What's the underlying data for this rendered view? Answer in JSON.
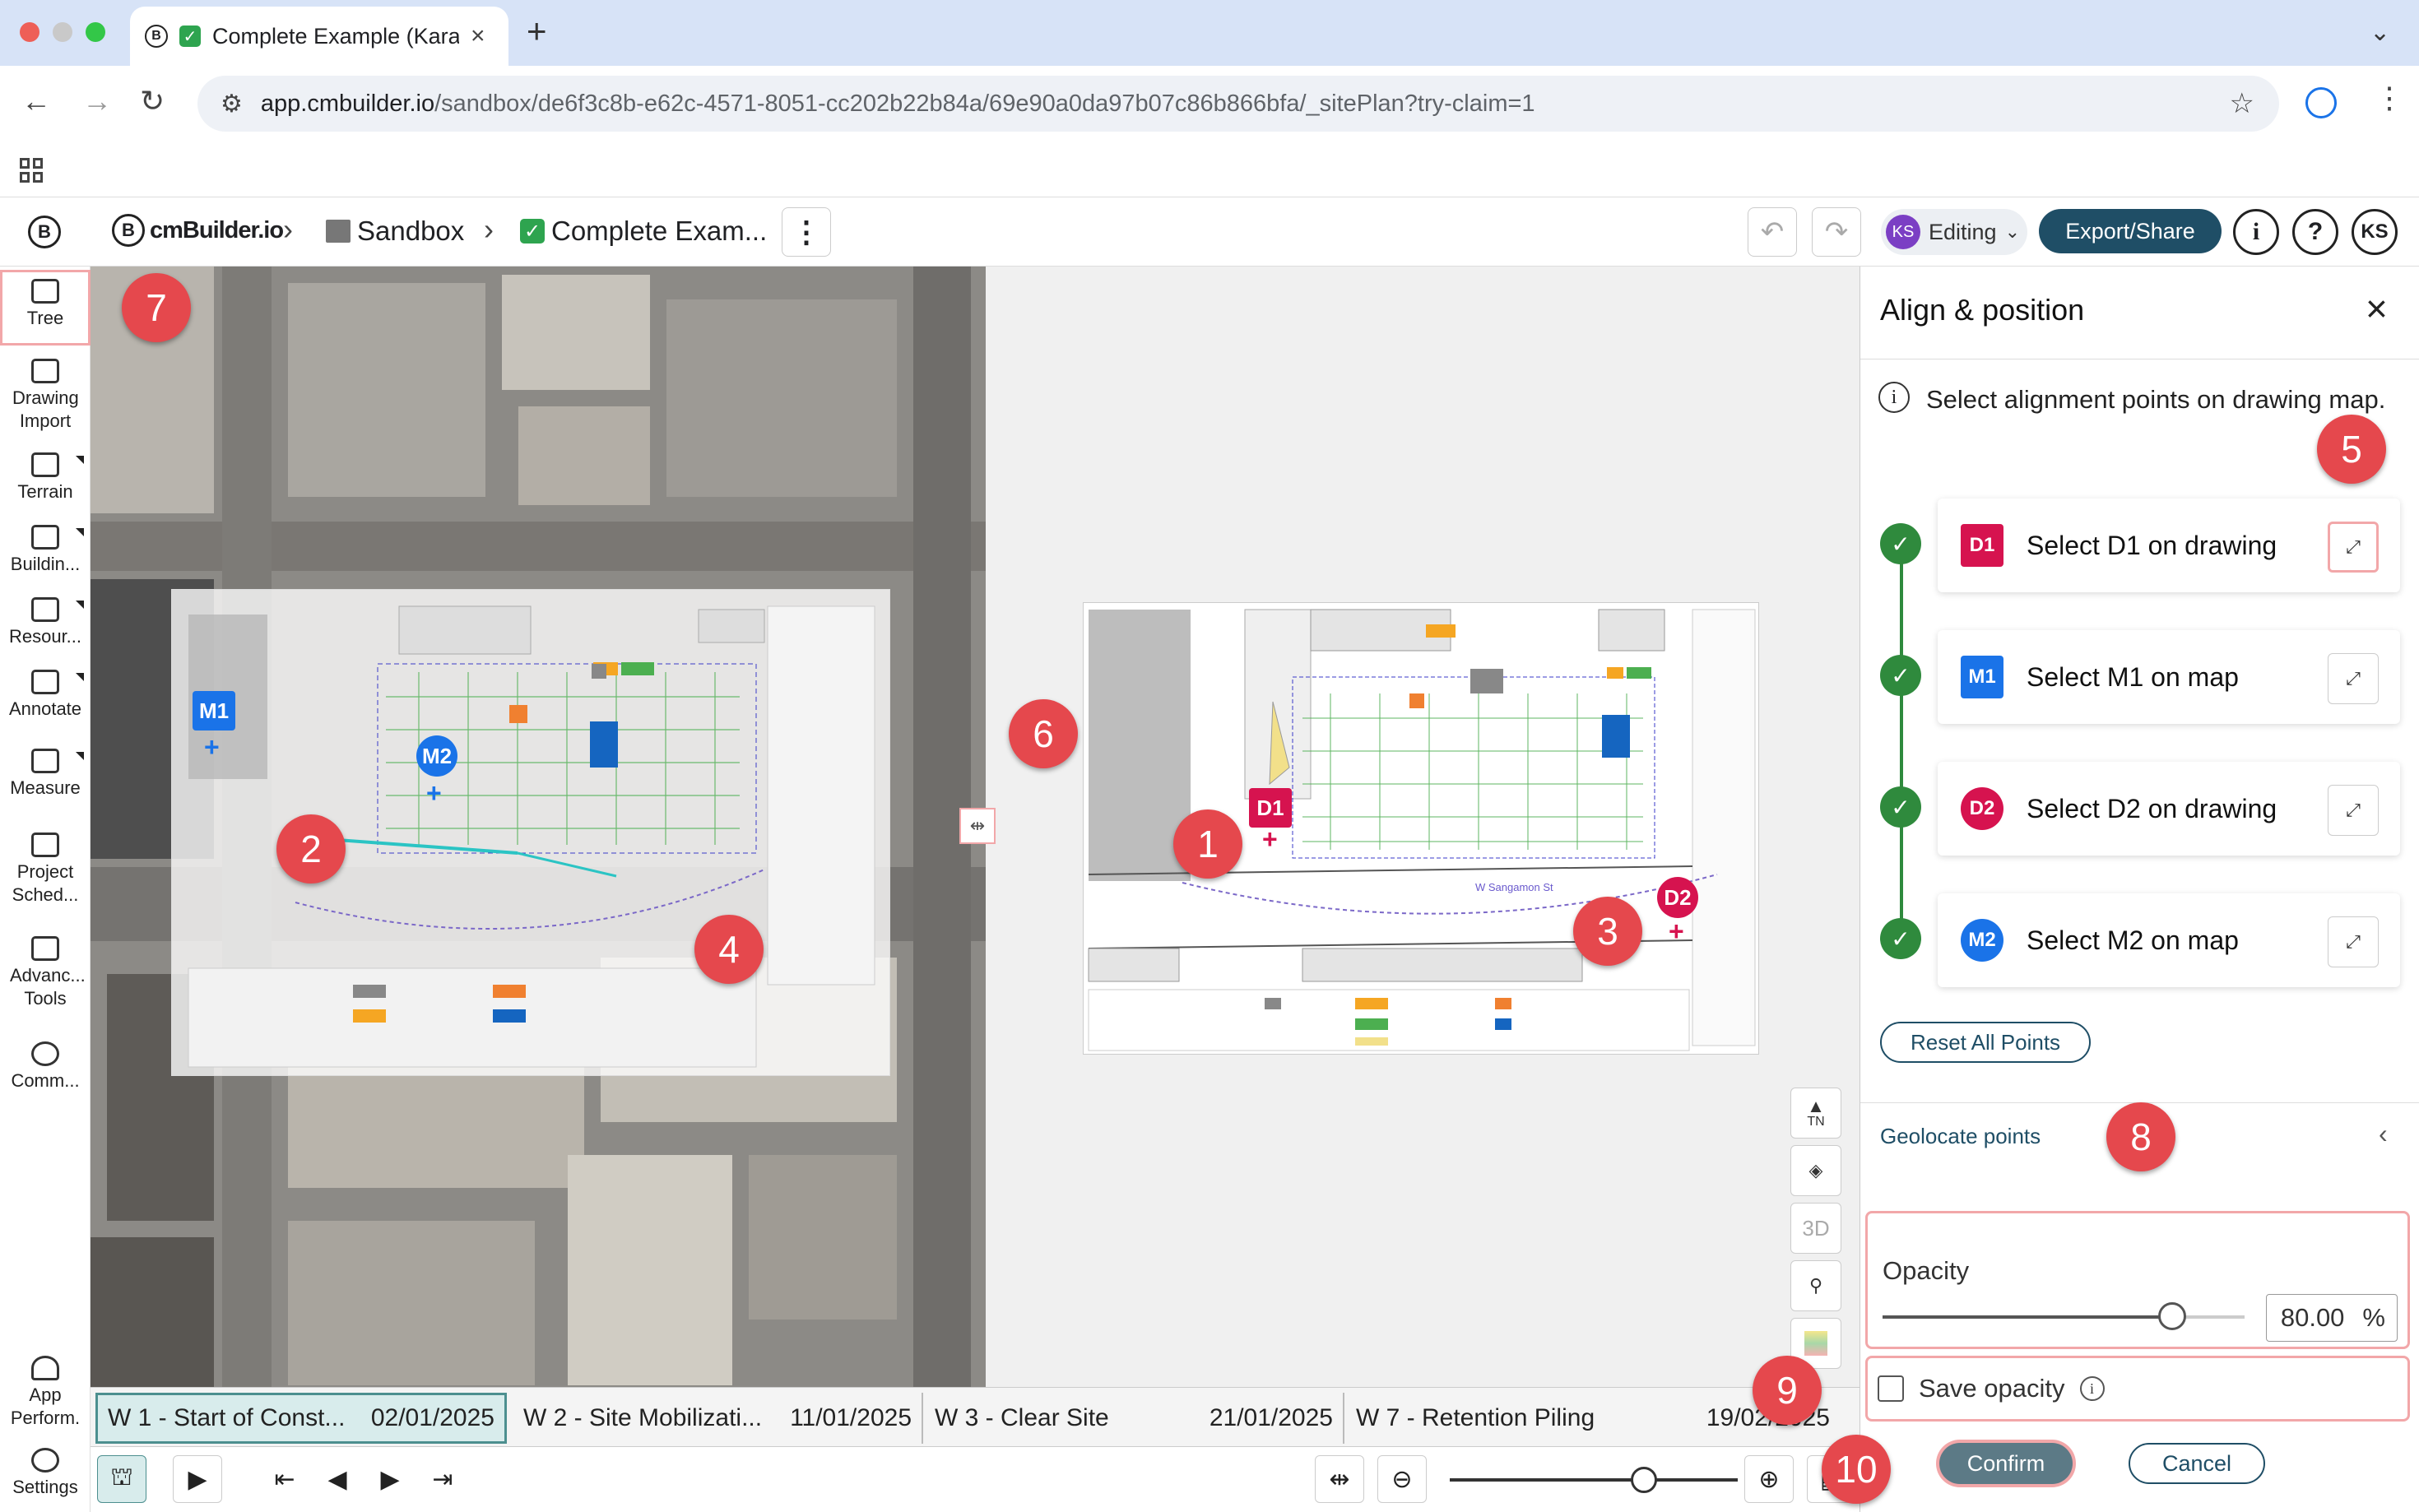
{
  "browser": {
    "tab_title": "Complete Example (Karan",
    "url_host": "app.cmbuilder.io",
    "url_path": "/sandbox/de6f3c8b-e62c-4571-8051-cc202b22b84a/69e90a0da97b07c86b866bfa/_sitePlan?try-claim=1"
  },
  "header": {
    "brand": "cmBuilder.io",
    "breadcrumb_sandbox": "Sandbox",
    "breadcrumb_project": "Complete Exam...",
    "mode": "Editing",
    "user_initials": "KS",
    "export_label": "Export/Share"
  },
  "toolbar": {
    "items": [
      {
        "label": "Tree"
      },
      {
        "label": "Drawing Import"
      },
      {
        "label": "Terrain"
      },
      {
        "label": "Buildin..."
      },
      {
        "label": "Resour..."
      },
      {
        "label": "Annotate"
      },
      {
        "label": "Measure"
      },
      {
        "label": "Project Sched..."
      },
      {
        "label": "Advanc... Tools"
      },
      {
        "label": "Comm..."
      },
      {
        "label": "App Perform."
      },
      {
        "label": "Settings"
      }
    ]
  },
  "map": {
    "markers": {
      "m1": "M1",
      "m2": "M2",
      "d1": "D1",
      "d2": "D2"
    },
    "street_label": "W Sangamon St",
    "controls": {
      "tn": "TN",
      "three_d": "3D"
    }
  },
  "callouts": [
    "1",
    "2",
    "3",
    "4",
    "5",
    "6",
    "7",
    "8",
    "9",
    "10"
  ],
  "timeline": {
    "phases": [
      {
        "name": "W 1 - Start of Const...",
        "date": "02/01/2025"
      },
      {
        "name": "W 2 - Site Mobilizati...",
        "date": "11/01/2025"
      },
      {
        "name": "W 3 - Clear Site",
        "date": "21/01/2025"
      },
      {
        "name": "W 7 - Retention Piling",
        "date": "19/02/2025"
      }
    ]
  },
  "panel": {
    "title": "Align & position",
    "info": "Select alignment points on drawing map.",
    "steps": [
      {
        "badge": "D1",
        "label": "Select D1 on drawing"
      },
      {
        "badge": "M1",
        "label": "Select M1 on map"
      },
      {
        "badge": "D2",
        "label": "Select D2 on drawing"
      },
      {
        "badge": "M2",
        "label": "Select M2 on map"
      }
    ],
    "reset_label": "Reset All Points",
    "geolocate_label": "Geolocate points",
    "opacity_label": "Opacity",
    "opacity_value": "80.00",
    "opacity_unit": "%",
    "opacity_fraction": 0.8,
    "save_opacity_label": "Save opacity",
    "confirm_label": "Confirm",
    "cancel_label": "Cancel"
  },
  "colors": {
    "accent": "#1f4e66",
    "map_marker_blue": "#1a73e8",
    "drawing_marker_red": "#d6134f",
    "callout_red": "#e5484d",
    "step_done_green": "#2f8a3d"
  }
}
